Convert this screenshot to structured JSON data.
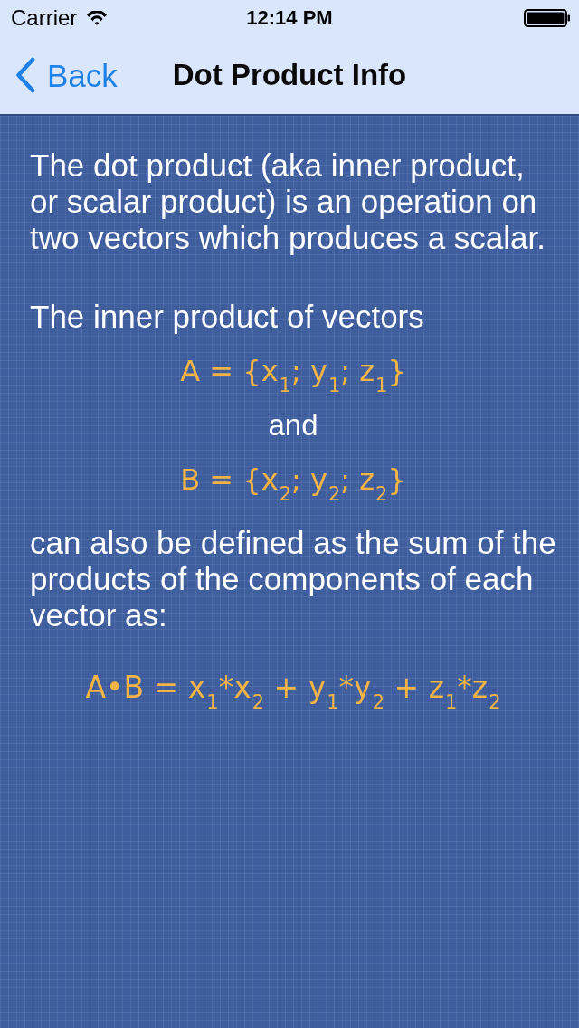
{
  "status_bar": {
    "carrier": "Carrier",
    "time": "12:14 PM"
  },
  "nav_bar": {
    "back": "Back",
    "title": "Dot Product Info"
  },
  "content": [
    {
      "kind": "paragraph",
      "text": "The dot product (aka inner product, or scalar product) is an operation on two vectors which produces a scalar."
    },
    {
      "kind": "paragraph",
      "text": "The inner product of vectors"
    },
    {
      "kind": "formula",
      "parts": [
        {
          "text": "A = {x",
          "sub": "1"
        },
        {
          "text": "; y",
          "sub": "1"
        },
        {
          "text": "; z",
          "sub": "1"
        },
        {
          "text": "}"
        }
      ]
    },
    {
      "kind": "centered",
      "text": "and"
    },
    {
      "kind": "formula",
      "parts": [
        {
          "text": "B = {x",
          "sub": "2"
        },
        {
          "text": "; y",
          "sub": "2"
        },
        {
          "text": "; z",
          "sub": "2"
        },
        {
          "text": "}"
        }
      ]
    },
    {
      "kind": "paragraph",
      "text": "can also be defined as the sum of the products of the components of each vector as:"
    },
    {
      "kind": "formula",
      "parts": [
        {
          "text": "A•B = x",
          "sub": "1"
        },
        {
          "text": "*x",
          "sub": "2"
        },
        {
          "text": " + y",
          "sub": "1"
        },
        {
          "text": "*y",
          "sub": "2"
        },
        {
          "text": " + z",
          "sub": "1"
        },
        {
          "text": "*z",
          "sub": "2"
        }
      ]
    }
  ]
}
